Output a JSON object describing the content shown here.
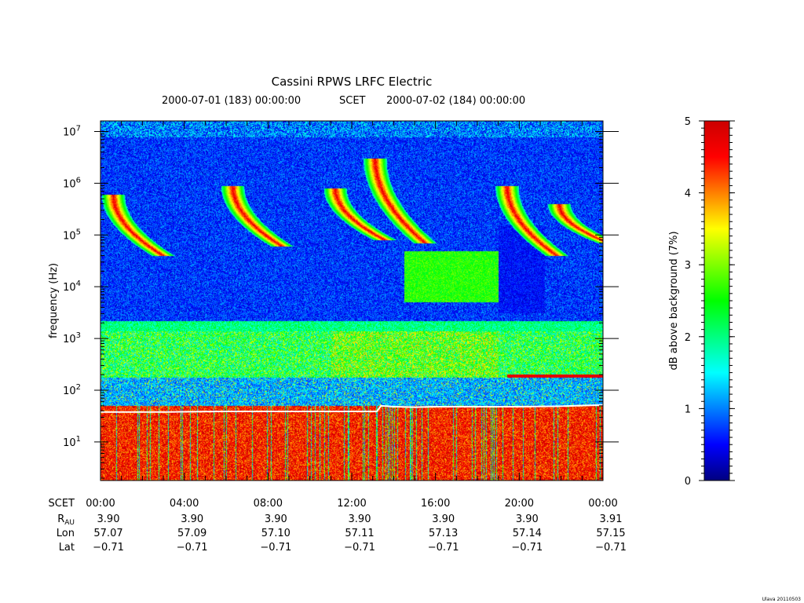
{
  "chart_data": {
    "type": "heatmap",
    "title": "Cassini RPWS LRFC Electric",
    "subtitle_left": "2000-07-01 (183) 00:00:00",
    "subtitle_mid": "SCET",
    "subtitle_right": "2000-07-02 (184) 00:00:00",
    "ylabel": "frequency (Hz)",
    "yscale": "log",
    "ylim": [
      1.8,
      16000000
    ],
    "yticks": [
      {
        "value": 10,
        "base": "10",
        "exp": "1"
      },
      {
        "value": 100,
        "base": "10",
        "exp": "2"
      },
      {
        "value": 1000,
        "base": "10",
        "exp": "3"
      },
      {
        "value": 10000,
        "base": "10",
        "exp": "4"
      },
      {
        "value": 100000,
        "base": "10",
        "exp": "5"
      },
      {
        "value": 1000000,
        "base": "10",
        "exp": "6"
      },
      {
        "value": 10000000,
        "base": "10",
        "exp": "7"
      }
    ],
    "xlim_hours": [
      0,
      24
    ],
    "xticks": [
      {
        "hour": 0,
        "label": "00:00"
      },
      {
        "hour": 4,
        "label": "04:00"
      },
      {
        "hour": 8,
        "label": "08:00"
      },
      {
        "hour": 12,
        "label": "12:00"
      },
      {
        "hour": 16,
        "label": "16:00"
      },
      {
        "hour": 20,
        "label": "20:00"
      },
      {
        "hour": 24,
        "label": "00:00"
      }
    ],
    "colorbar": {
      "label": "dB above background (7%)",
      "range": [
        0,
        5
      ],
      "ticks": [
        "0",
        "1",
        "2",
        "3",
        "4",
        "5"
      ],
      "colors": [
        "#000080",
        "#0000ff",
        "#0080ff",
        "#00ffff",
        "#00ff80",
        "#00ff00",
        "#80ff00",
        "#ffff00",
        "#ff8000",
        "#ff0000",
        "#cc0000"
      ]
    },
    "ephemeris": [
      {
        "label": "SCET",
        "sub": "",
        "values": [
          "00:00",
          "04:00",
          "08:00",
          "12:00",
          "16:00",
          "20:00",
          "00:00"
        ]
      },
      {
        "label": "R",
        "sub": "AU",
        "values": [
          "3.90",
          "3.90",
          "3.90",
          "3.90",
          "3.90",
          "3.90",
          "3.91"
        ]
      },
      {
        "label": "Lon",
        "sub": "",
        "values": [
          "57.07",
          "57.09",
          "57.10",
          "57.11",
          "57.13",
          "57.14",
          "57.15"
        ]
      },
      {
        "label": "Lat",
        "sub": "",
        "values": [
          "-0.71",
          "-0.71",
          "-0.71",
          "-0.71",
          "-0.71",
          "-0.71",
          "-0.71"
        ]
      }
    ],
    "white_line_hz": [
      [
        0,
        38
      ],
      [
        3,
        38
      ],
      [
        6,
        39
      ],
      [
        9,
        39
      ],
      [
        12,
        39
      ],
      [
        13.2,
        39
      ],
      [
        13.4,
        50
      ],
      [
        14,
        48
      ],
      [
        15,
        47
      ],
      [
        16,
        48
      ],
      [
        18,
        48
      ],
      [
        20,
        48
      ],
      [
        22,
        49
      ],
      [
        24,
        52
      ]
    ],
    "features": {
      "radio_bursts": [
        {
          "start_hour": 0.6,
          "top_hz": 600000,
          "bottom_hz": 40000
        },
        {
          "start_hour": 6.3,
          "top_hz": 900000,
          "bottom_hz": 60000
        },
        {
          "start_hour": 11.2,
          "top_hz": 800000,
          "bottom_hz": 80000
        },
        {
          "start_hour": 13.1,
          "top_hz": 3000000,
          "bottom_hz": 70000
        },
        {
          "start_hour": 19.4,
          "top_hz": 900000,
          "bottom_hz": 40000
        },
        {
          "start_hour": 21.9,
          "top_hz": 400000,
          "bottom_hz": 70000
        }
      ],
      "red_band_hz": 190,
      "red_band_hours": [
        19.4,
        24
      ]
    }
  },
  "footer": {
    "credit": "Ulava 20110503"
  }
}
